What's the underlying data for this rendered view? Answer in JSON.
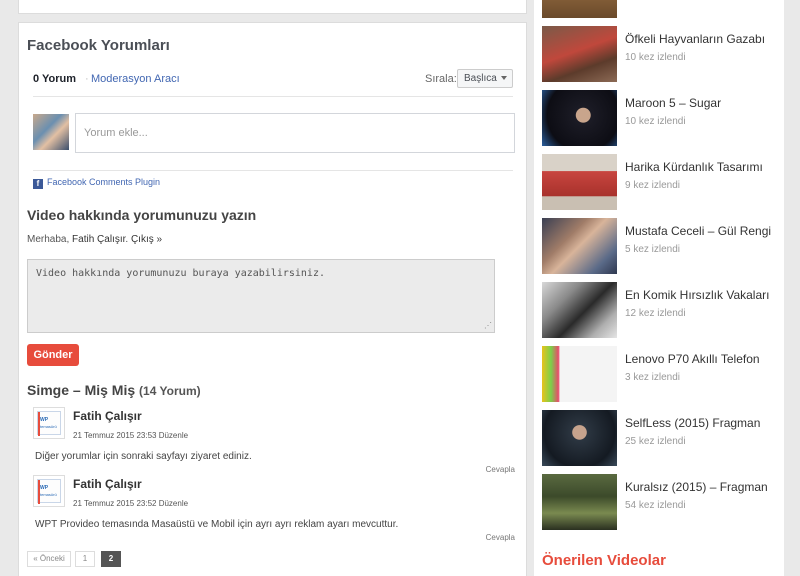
{
  "facebook": {
    "title": "Facebook Yorumları",
    "comment_count": "0 Yorum",
    "separator": "·",
    "moderation": "Moderasyon Aracı",
    "sort_label": "Sırala:",
    "sort_value": "Başlıca",
    "input_placeholder": "Yorum ekle...",
    "plugin_label": "Facebook Comments Plugin",
    "plugin_icon": "f"
  },
  "reply": {
    "title": "Video hakkında yorumunuzu yazın",
    "greeting_prefix": "Merhaba, ",
    "user_name": "Fatih Çalışır",
    "greeting_sep": ". ",
    "logout": "Çıkış »",
    "textarea_placeholder": "Video hakkında yorumunuzu buraya yazabilirsiniz.",
    "submit": "Gönder"
  },
  "thread": {
    "title": "Simge – Miş Miş",
    "count": "(14 Yorum)",
    "comments": [
      {
        "name": "Fatih Çalışır",
        "date": "21 Temmuz 2015 23:53",
        "edit": "Düzenle",
        "text": "Diğer yorumlar için sonraki sayfayı ziyaret ediniz.",
        "reply": "Cevapla",
        "avatar_wp": "WP",
        "avatar_tm": "temasürü"
      },
      {
        "name": "Fatih Çalışır",
        "date": "21 Temmuz 2015 23:52",
        "edit": "Düzenle",
        "text": "WPT Provideo temasında Masaüstü ve Mobil için ayrı ayrı reklam ayarı mevcuttur.",
        "reply": "Cevapla",
        "avatar_wp": "WP",
        "avatar_tm": "temasürü"
      }
    ]
  },
  "pagination": {
    "prev": "« Önceki",
    "pages": [
      "1",
      "2"
    ],
    "current": "2"
  },
  "sidebar": {
    "videos": [
      {
        "title": "Öfkeli Hayvanların Gazabı",
        "views": "10 kez izlendi"
      },
      {
        "title": "Maroon 5 – Sugar",
        "views": "10 kez izlendi"
      },
      {
        "title": "Harika Kürdanlık Tasarımı",
        "views": "9 kez izlendi"
      },
      {
        "title": "Mustafa Ceceli – Gül Rengi",
        "views": "5 kez izlendi"
      },
      {
        "title": "En Komik Hırsızlık Vakaları",
        "views": "12 kez izlendi"
      },
      {
        "title": "Lenovo P70 Akıllı Telefon",
        "views": "3 kez izlendi"
      },
      {
        "title": "SelfLess (2015) Fragman",
        "views": "25 kez izlendi"
      },
      {
        "title": "Kuralsız (2015) – Fragman",
        "views": "54 kez izlendi"
      }
    ],
    "heading": "Önerilen Videolar"
  },
  "colors": {
    "accent": "#e74c3c",
    "facebook_blue": "#4267b2"
  }
}
